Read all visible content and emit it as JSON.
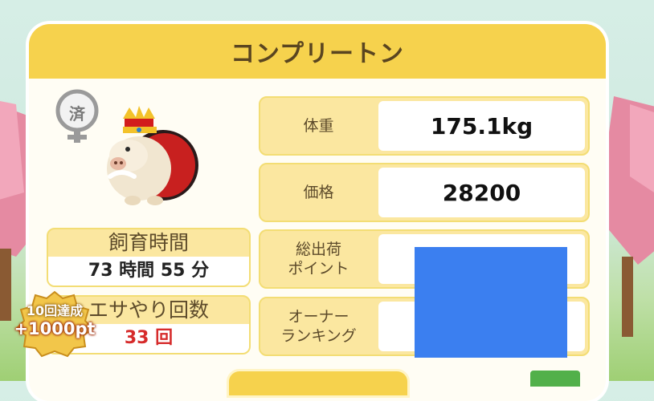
{
  "header": {
    "title": "コンプリートン"
  },
  "badge": {
    "done_label": "済"
  },
  "stats": {
    "weight": {
      "label": "体重",
      "value": "175.1kg"
    },
    "price": {
      "label": "価格",
      "value": "28200"
    },
    "total_points": {
      "label_line1": "総出荷",
      "label_line2": "ポイント"
    },
    "owner_ranking": {
      "label_line1": "オーナー",
      "label_line2": "ランキング"
    }
  },
  "raising_time": {
    "label": "飼育時間",
    "value": "73 時間 55 分"
  },
  "feeding_count": {
    "label": "エサやり回数",
    "value": "33 回"
  },
  "bonus": {
    "line1": "10回達成",
    "line2": "+1000pt"
  },
  "colors": {
    "header": "#f6d24d",
    "label_bg": "#fbe7a0",
    "count_red": "#d62b2b",
    "redaction": "#3b7ff0"
  }
}
